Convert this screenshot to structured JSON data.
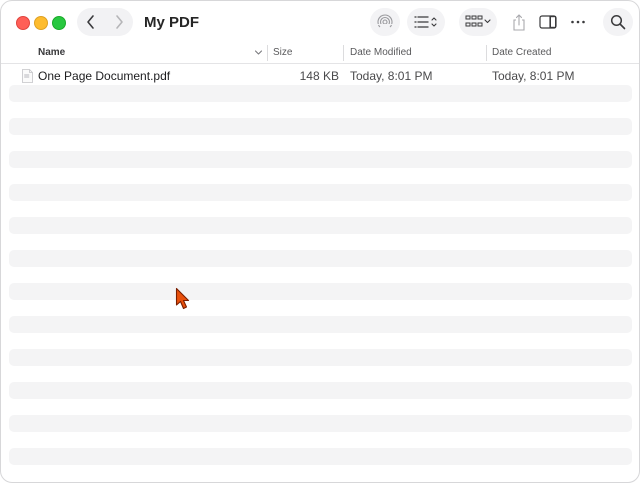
{
  "window": {
    "title": "My PDF"
  },
  "toolbar": {
    "icons": [
      "back-chevron-icon",
      "forward-chevron-icon",
      "airdrop-icon",
      "list-view-icon",
      "group-grid-icon",
      "share-icon",
      "sidebar-toggle-icon",
      "more-icon",
      "search-icon"
    ]
  },
  "columns": {
    "name": "Name",
    "size": "Size",
    "date_modified": "Date Modified",
    "date_created": "Date Created"
  },
  "files": [
    {
      "name": "One Page Document.pdf",
      "size": "148 KB",
      "date_modified": "Today, 8:01 PM",
      "date_created": "Today, 8:01 PM",
      "icon": "pdf-file-icon"
    }
  ],
  "colors": {
    "close": "#ff5f57",
    "minimize": "#febc2e",
    "maximize": "#28c840",
    "cursor": "#e8500c"
  }
}
